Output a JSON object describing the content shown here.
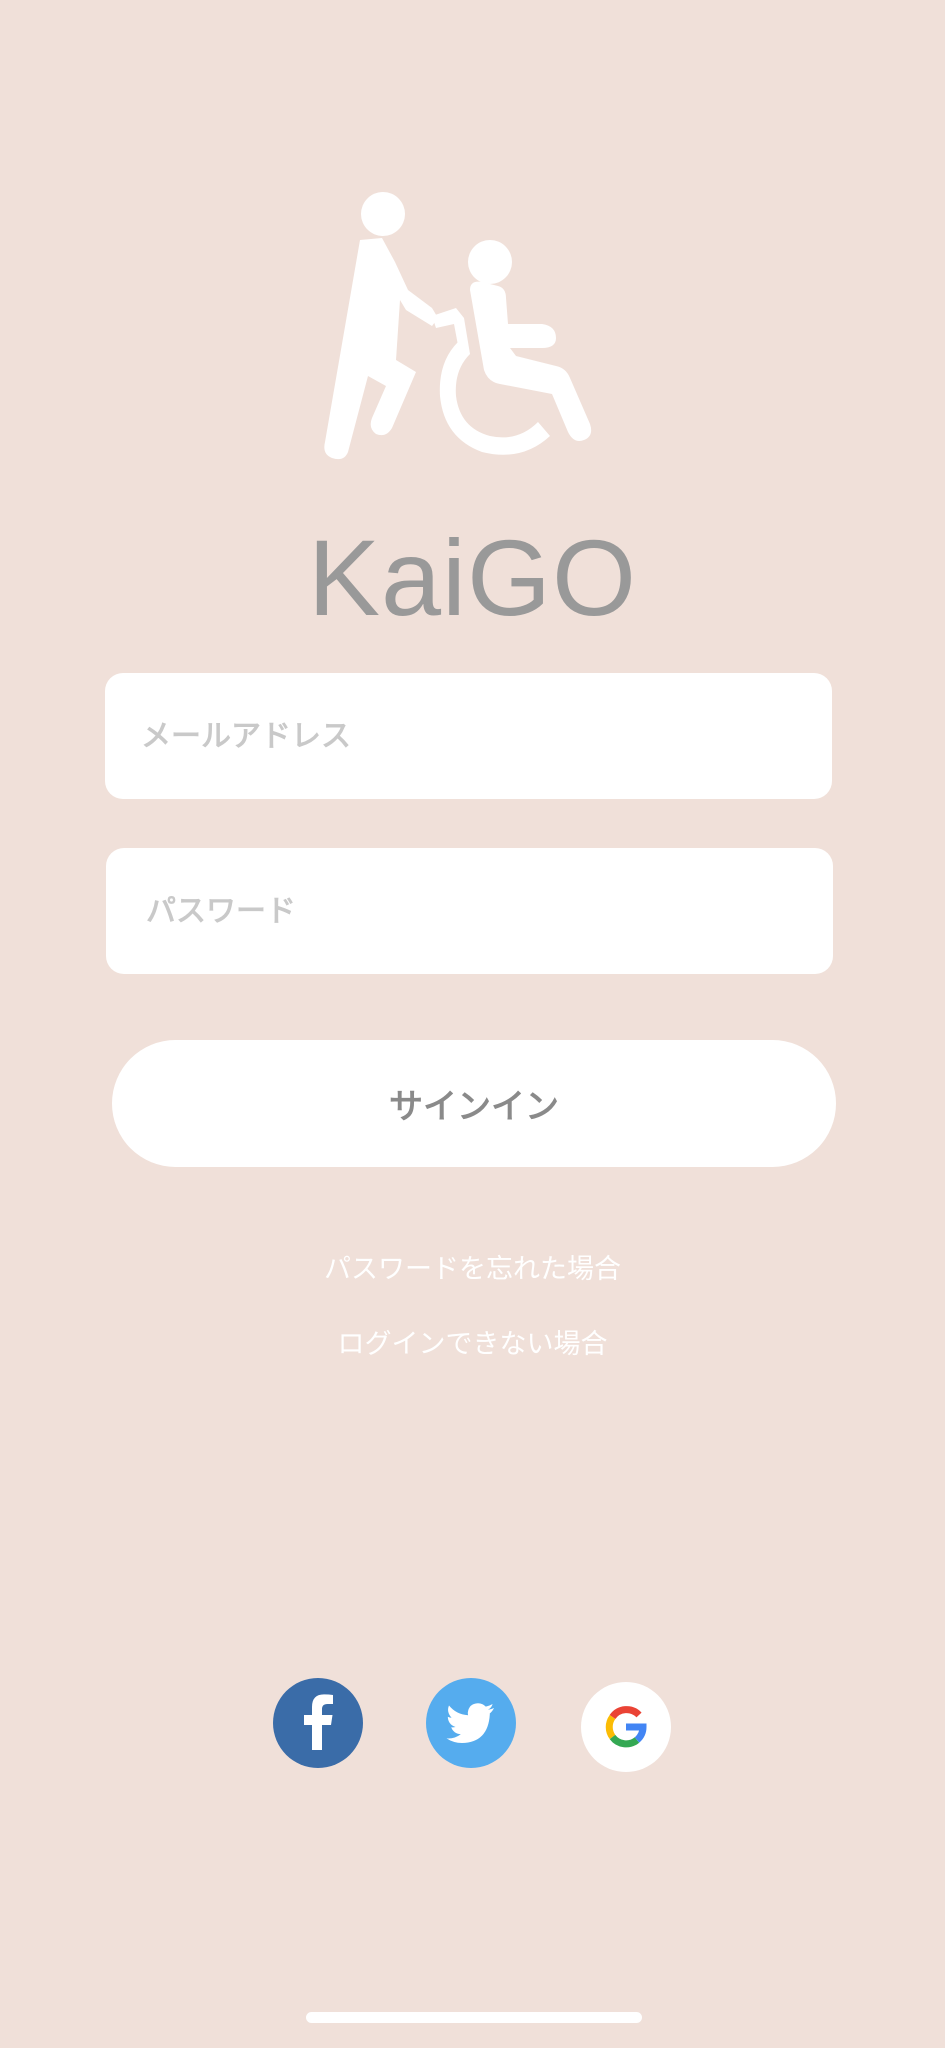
{
  "logo": {
    "icon": "caregiver-wheelchair-icon",
    "color": "#ffffff"
  },
  "app": {
    "title": "KaiGO"
  },
  "login_form": {
    "email_placeholder": "メールアドレス",
    "password_placeholder": "パスワード",
    "signin_label": "サインイン"
  },
  "links": {
    "forgot_password": "パスワードを忘れた場合",
    "cannot_login": "ログインできない場合"
  },
  "social_login": [
    {
      "icon": "facebook-icon",
      "color": "#3a6ca8"
    },
    {
      "icon": "twitter-icon",
      "color": "#55acee"
    },
    {
      "icon": "google-icon",
      "color": "#ffffff"
    }
  ],
  "theme": {
    "background": "#f0e0d9",
    "title_color": "#999999",
    "placeholder_color": "#c9c9c9"
  }
}
